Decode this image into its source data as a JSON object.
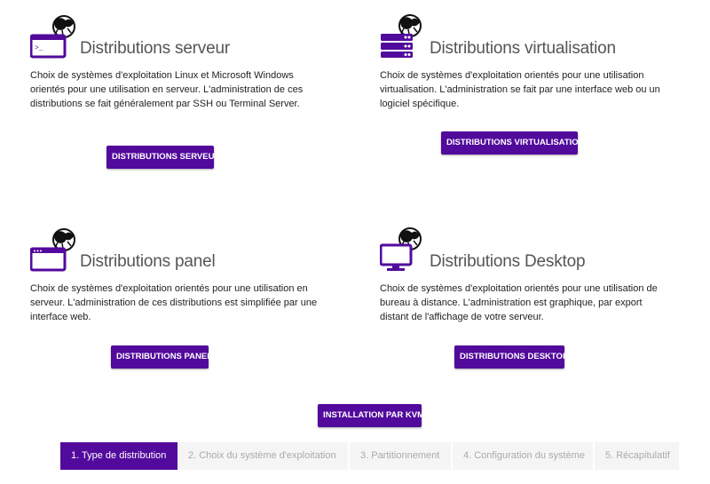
{
  "colors": {
    "accent": "#520a9c",
    "step_inactive_bg": "#f5f5f5",
    "step_inactive_text": "#aaaaaa"
  },
  "cards": [
    {
      "icon": "terminal-window-with-gnu-icon",
      "title": "Distributions serveur",
      "description": "Choix de systèmes d'exploitation Linux et Microsoft Windows orientés pour une utilisation en serveur. L'administration de ces distributions se fait généralement par SSH ou Terminal Server.",
      "button": "DISTRIBUTIONS SERVEUR"
    },
    {
      "icon": "server-rack-with-gnu-icon",
      "title": "Distributions virtualisation",
      "description": "Choix de systèmes d'exploitation orientés pour une utilisation virtualisation. L'administration se fait par une interface web ou un logiciel spécifique.",
      "button": "DISTRIBUTIONS VIRTUALISATION"
    },
    {
      "icon": "browser-window-with-gnu-icon",
      "title": "Distributions panel",
      "description": "Choix de systèmes d'exploitation orientés pour une utilisation en serveur. L'administration de ces distributions est simplifiée par une interface web.",
      "button": "DISTRIBUTIONS PANEL"
    },
    {
      "icon": "monitor-with-gnu-icon",
      "title": "Distributions Desktop",
      "description": "Choix de systèmes d'exploitation orientés pour une utilisation de bureau à distance. L'administration est graphique, par export distant de l'affichage de votre serveur.",
      "button": "DISTRIBUTIONS DESKTOP"
    }
  ],
  "kvm_button": "INSTALLATION PAR KVM",
  "steps": [
    {
      "label": "1. Type de distribution",
      "active": true
    },
    {
      "label": "2. Choix du système d'exploitation",
      "active": false
    },
    {
      "label": "3. Partitionnement",
      "active": false
    },
    {
      "label": "4. Configuration du système",
      "active": false
    },
    {
      "label": "5. Récapitulatif",
      "active": false
    }
  ]
}
